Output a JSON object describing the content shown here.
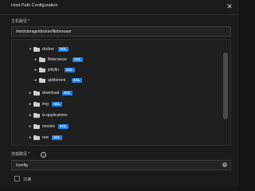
{
  "dialog": {
    "title": "Host Path Configuration",
    "close_glyph": "✕"
  },
  "host_path": {
    "label": "主机路径",
    "required_mark": "*",
    "value": "/mnt/storage/docker/filebrowser"
  },
  "tree": {
    "clipped_label": "storage",
    "items": [
      {
        "name": "docker",
        "expanded": true,
        "acl": "ACL"
      },
      {
        "name": "filebrowser",
        "expanded": false,
        "acl": "ACL"
      },
      {
        "name": "jellyfin",
        "expanded": false,
        "acl": "ACL"
      },
      {
        "name": "qbittorrent",
        "expanded": false,
        "acl": "ACL"
      },
      {
        "name": "download",
        "expanded": false,
        "acl": "ACL"
      },
      {
        "name": "img",
        "expanded": false,
        "acl": "ACL"
      },
      {
        "name": "ix-applications",
        "expanded": false,
        "acl": ""
      },
      {
        "name": "movies",
        "expanded": false,
        "acl": "ACL"
      },
      {
        "name": "raw",
        "expanded": false,
        "acl": "ACL"
      }
    ]
  },
  "mount_path": {
    "label": "挂载路径",
    "required_mark": "*",
    "help_glyph": "?",
    "value": "/config",
    "clear_glyph": "×"
  },
  "readonly": {
    "label": "只读",
    "checked": false
  },
  "icons": {
    "expanded_caret": "▾",
    "collapsed_caret": "▸"
  },
  "colors": {
    "background": "#1b1b1b",
    "acl_badge": "#1f7fe6",
    "text": "#e0e0e0"
  }
}
